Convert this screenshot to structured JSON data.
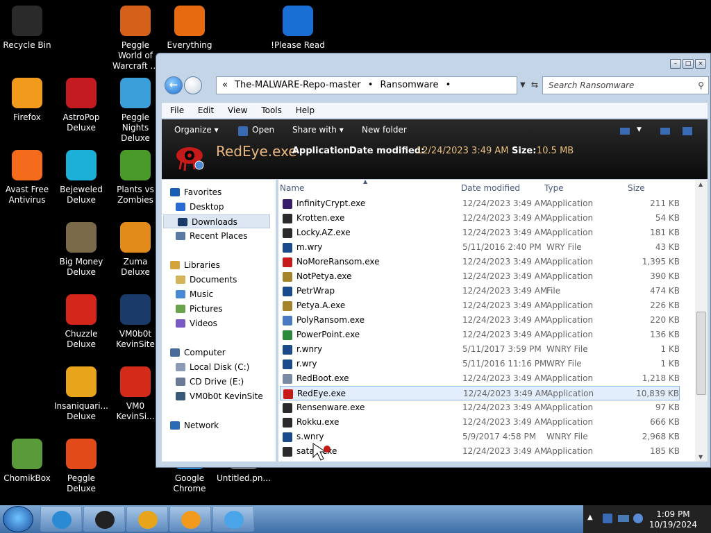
{
  "desktop_icons": [
    {
      "label": "Recycle Bin",
      "color": "#2a2a2a"
    },
    {
      "label": "Peggle World of Warcraft ...",
      "color": "#d4601a"
    },
    {
      "label": "Everything",
      "color": "#e86a10"
    },
    {
      "label": "!Please Read",
      "color": "#1a6fd4"
    },
    {
      "label": "Firefox",
      "color": "#f29a1b"
    },
    {
      "label": "AstroPop Deluxe",
      "color": "#c41a22"
    },
    {
      "label": "Peggle Nights Deluxe",
      "color": "#3a9fd8"
    },
    {
      "label": "Avast Free Antivirus",
      "color": "#f56b1c"
    },
    {
      "label": "Bejeweled Deluxe",
      "color": "#1ab0d8"
    },
    {
      "label": "Plants vs Zombies",
      "color": "#4a9a2a"
    },
    {
      "label": "Big Money Deluxe",
      "color": "#7a6a4a"
    },
    {
      "label": "Zuma Deluxe",
      "color": "#e28a1a"
    },
    {
      "label": "Chuzzle Deluxe",
      "color": "#d4261a"
    },
    {
      "label": "VM0b0t KevinSite",
      "color": "#1a3a6a"
    },
    {
      "label": "Insaniquari... Deluxe",
      "color": "#e8a41a"
    },
    {
      "label": "VM0 KevinSi...",
      "color": "#d42a1a"
    },
    {
      "label": "ChomikBox",
      "color": "#5a9a3a"
    },
    {
      "label": "Peggle Deluxe",
      "color": "#e24a1a"
    },
    {
      "label": "Google Chrome",
      "color": "#2a8ad4"
    },
    {
      "label": "Untitled.pn...",
      "color": "#777777"
    }
  ],
  "window": {
    "breadcrumb": [
      "«",
      "The-MALWARE-Repo-master",
      "•",
      "Ransomware",
      "•"
    ],
    "search_placeholder": "Search Ransomware",
    "menu": [
      "File",
      "Edit",
      "View",
      "Tools",
      "Help"
    ],
    "commands": [
      "Organize ▾",
      "Open",
      "Share with ▾",
      "New folder"
    ],
    "details": {
      "name": "RedEye.exe",
      "type": "Application",
      "date_label": "Date modified:",
      "date": "12/24/2023 3:49 AM",
      "size_label": "Size:",
      "size": "10.5 MB"
    },
    "nav": [
      {
        "label": "Favorites",
        "header": true,
        "color": "#1a5fb4"
      },
      {
        "label": "Desktop",
        "color": "#2a6ad4"
      },
      {
        "label": "Downloads",
        "selected": true,
        "color": "#1a3a6a"
      },
      {
        "label": "Recent Places",
        "color": "#5a7aa4"
      },
      {
        "label": "Libraries",
        "header": true,
        "color": "#d4a43a"
      },
      {
        "label": "Documents",
        "color": "#d4b45a"
      },
      {
        "label": "Music",
        "color": "#4a8ad4"
      },
      {
        "label": "Pictures",
        "color": "#6aa44a"
      },
      {
        "label": "Videos",
        "color": "#7a5ac4"
      },
      {
        "label": "Computer",
        "header": true,
        "color": "#4a6a9a"
      },
      {
        "label": "Local Disk (C:)",
        "color": "#8a9ab4"
      },
      {
        "label": "CD Drive (E:)",
        "color": "#6a7a94"
      },
      {
        "label": "VM0b0t KevinSite",
        "color": "#3a5a7a"
      },
      {
        "label": "Network",
        "header": true,
        "color": "#2a6ab4"
      }
    ],
    "columns": [
      "Name",
      "Date modified",
      "Type",
      "Size"
    ],
    "files": [
      {
        "name": "InfinityCrypt.exe",
        "date": "12/24/2023 3:49 AM",
        "type": "Application",
        "size": "211 KB",
        "color": "#3a1a6a"
      },
      {
        "name": "Krotten.exe",
        "date": "12/24/2023 3:49 AM",
        "type": "Application",
        "size": "54 KB",
        "color": "#2a2a2a"
      },
      {
        "name": "Locky.AZ.exe",
        "date": "12/24/2023 3:49 AM",
        "type": "Application",
        "size": "181 KB",
        "color": "#2a2a2a"
      },
      {
        "name": "m.wry",
        "date": "5/11/2016 2:40 PM",
        "type": "WRY File",
        "size": "43 KB",
        "color": "#1a4a8a"
      },
      {
        "name": "NoMoreRansom.exe",
        "date": "12/24/2023 3:49 AM",
        "type": "Application",
        "size": "1,395 KB",
        "color": "#c41a1a"
      },
      {
        "name": "NotPetya.exe",
        "date": "12/24/2023 3:49 AM",
        "type": "Application",
        "size": "390 KB",
        "color": "#a4842a"
      },
      {
        "name": "PetrWrap",
        "date": "12/24/2023 3:49 AM",
        "type": "File",
        "size": "474 KB",
        "color": "#1a4a8a"
      },
      {
        "name": "Petya.A.exe",
        "date": "12/24/2023 3:49 AM",
        "type": "Application",
        "size": "226 KB",
        "color": "#a4842a"
      },
      {
        "name": "PolyRansom.exe",
        "date": "12/24/2023 3:49 AM",
        "type": "Application",
        "size": "220 KB",
        "color": "#4a7ac4"
      },
      {
        "name": "PowerPoint.exe",
        "date": "12/24/2023 3:49 AM",
        "type": "Application",
        "size": "136 KB",
        "color": "#2a8a3a"
      },
      {
        "name": "r.wnry",
        "date": "5/11/2017 3:59 PM",
        "type": "WNRY File",
        "size": "1 KB",
        "color": "#1a4a8a"
      },
      {
        "name": "r.wry",
        "date": "5/11/2016 11:16 PM",
        "type": "WRY File",
        "size": "1 KB",
        "color": "#1a4a8a"
      },
      {
        "name": "RedBoot.exe",
        "date": "12/24/2023 3:49 AM",
        "type": "Application",
        "size": "1,218 KB",
        "color": "#7a8aa4"
      },
      {
        "name": "RedEye.exe",
        "date": "12/24/2023 3:49 AM",
        "type": "Application",
        "size": "10,839 KB",
        "color": "#c41a1a",
        "selected": true
      },
      {
        "name": "Rensenware.exe",
        "date": "12/24/2023 3:49 AM",
        "type": "Application",
        "size": "97 KB",
        "color": "#2a2a2a"
      },
      {
        "name": "Rokku.exe",
        "date": "12/24/2023 3:49 AM",
        "type": "Application",
        "size": "666 KB",
        "color": "#2a2a2a"
      },
      {
        "name": "s.wnry",
        "date": "5/9/2017 4:58 PM",
        "type": "WNRY File",
        "size": "2,968 KB",
        "color": "#1a4a8a"
      },
      {
        "name": "satan.exe",
        "date": "12/24/2023 3:49 AM",
        "type": "Application",
        "size": "185 KB",
        "color": "#2a2a2a"
      }
    ]
  },
  "taskbar": {
    "items": [
      {
        "name": "Chrome",
        "color": "#2a8ad4"
      },
      {
        "name": "Explorer",
        "color": "#222222"
      },
      {
        "name": "Media Player",
        "color": "#e8a41a"
      },
      {
        "name": "Firefox",
        "color": "#f29a1b"
      },
      {
        "name": "Users",
        "color": "#4aa4e8"
      }
    ],
    "time": "1:09 PM",
    "date": "10/19/2024"
  }
}
